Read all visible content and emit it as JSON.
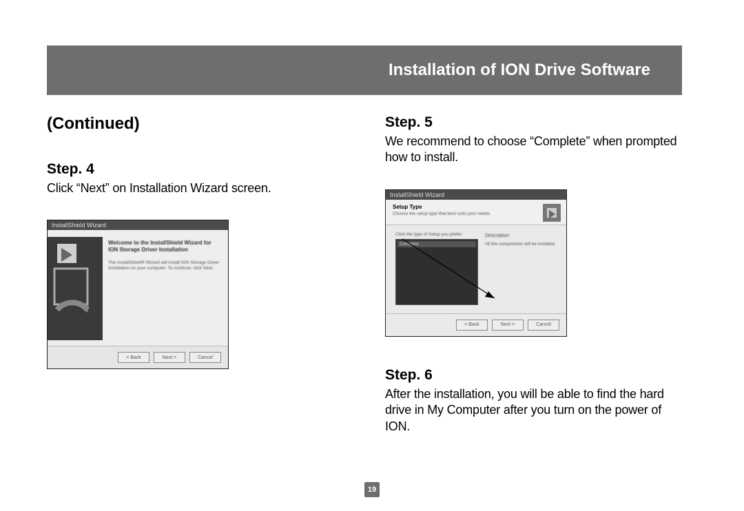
{
  "header": {
    "title": "Installation of ION Drive Software"
  },
  "continued": "(Continued)",
  "left": {
    "step4": {
      "heading": "Step. 4",
      "body": "Click “Next” on Installation Wizard screen.",
      "wizard": {
        "window_title": "InstallShield Wizard",
        "main_title": "Welcome to the InstallShield Wizard for ION Storage Driver Installation",
        "main_text": "The InstallShield® Wizard will install ION Storage Driver Installation on your computer. To continue, click Next.",
        "buttons": {
          "back": "< Back",
          "next": "Next >",
          "cancel": "Cancel"
        }
      }
    }
  },
  "right": {
    "step5": {
      "heading": "Step. 5",
      "body": "We recommend to choose “Complete” when prompted how to install.",
      "wizard": {
        "window_title": "InstallShield Wizard",
        "head_title": "Setup Type",
        "head_sub": "Choose the setup type that best suits your needs.",
        "list_caption": "Click the type of Setup you prefer.",
        "list_item": "Complete",
        "desc_title": "Description",
        "desc_text": "All the components will be installed.",
        "buttons": {
          "back": "< Back",
          "next": "Next >",
          "cancel": "Cancel"
        }
      }
    },
    "step6": {
      "heading": "Step. 6",
      "body": "After the installation, you will be able to find the hard drive in My Computer after you turn on the power of ION."
    }
  },
  "page_number": "19"
}
